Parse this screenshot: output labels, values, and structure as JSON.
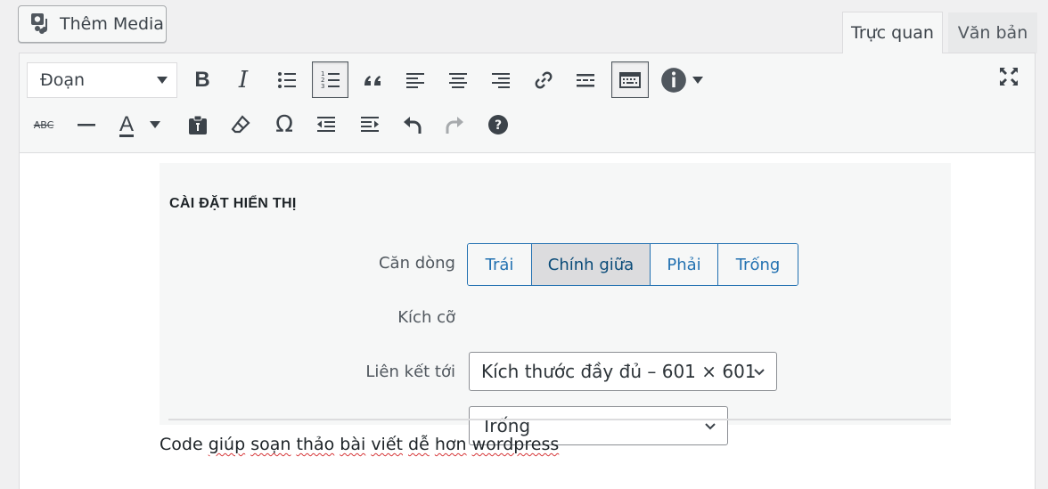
{
  "add_media": {
    "label": "Thêm Media"
  },
  "tabs": {
    "visual": "Trực quan",
    "text": "Văn bản"
  },
  "toolbar": {
    "format_select": "Đoạn",
    "row1": [
      "bold",
      "italic",
      "bulleted-list",
      "numbered-list",
      "blockquote",
      "align-left",
      "align-center",
      "align-right",
      "link",
      "read-more",
      "toolbar-toggle",
      "wp-help-dropdown"
    ],
    "row2": [
      "strikethrough",
      "horizontal-line",
      "text-color",
      "paste-as-text",
      "clear-formatting",
      "special-character",
      "outdent",
      "indent",
      "undo",
      "redo",
      "keyboard-shortcuts"
    ],
    "bold_glyph": "B",
    "italic_glyph": "I",
    "text_color_glyph": "A",
    "strike_glyph": "ABC",
    "omega_glyph": "Ω"
  },
  "settings": {
    "title": "CÀI ĐẶT HIỂN THỊ",
    "align_label": "Căn dòng",
    "align_options": [
      "Trái",
      "Chính giữa",
      "Phải",
      "Trống"
    ],
    "align_selected": "Chính giữa",
    "size_label": "Kích cỡ",
    "size_value": "Kích thước đầy đủ – 601 × 601",
    "link_label": "Liên kết tới",
    "link_value": "Trống"
  },
  "content": {
    "words": [
      "Code",
      "giúp",
      "soạn",
      "thảo",
      "bài",
      "viết",
      "dễ",
      "hơn",
      "wordpress"
    ]
  },
  "colors": {
    "accent": "#2271b1",
    "spellcheck": "#d63638"
  }
}
